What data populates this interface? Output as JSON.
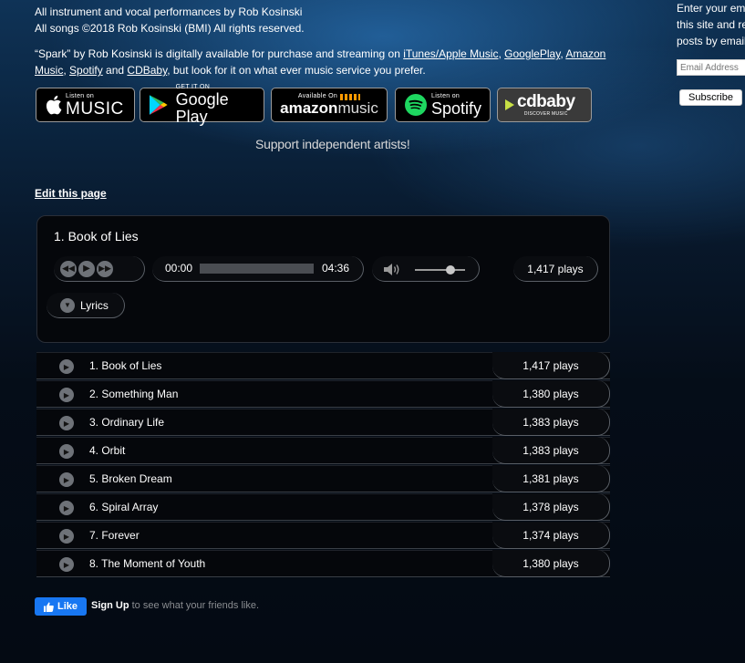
{
  "credits": {
    "line1": "All instrument and vocal performances by Rob Kosinski",
    "line2": "All songs ©2018 Rob Kosinski (BMI) All rights reserved.",
    "availability_pre": "“Spark” by Rob Kosinski is digitally available for purchase and streaming on ",
    "itunes_link": "iTunes/Apple Music",
    "comma1": ", ",
    "googleplay_link": "GooglePlay",
    "comma2": ", ",
    "amazon_link": "Amazon Music",
    "comma3": ", ",
    "spotify_link": "Spotify",
    "and_text": " and ",
    "cdbaby_link": "CDBaby",
    "availability_post": ", but look for it on what ever music service you prefer."
  },
  "badges": {
    "apple": {
      "small": "Listen on",
      "big": "MUSIC"
    },
    "google": {
      "small": "GET IT ON",
      "big": "Google Play"
    },
    "amazon": {
      "small": "Available On",
      "big": "amazon",
      "big2": "music"
    },
    "spotify": {
      "small": "Listen on",
      "big": "Spotify"
    },
    "cdbaby": {
      "big": "cdbaby",
      "small": "DISCOVER MUSIC"
    }
  },
  "support_text": "Support independent artists!",
  "edit_link": "Edit this page",
  "player": {
    "now_playing": "1. Book of Lies",
    "current_time": "00:00",
    "duration": "04:36",
    "plays": "1,417 plays",
    "lyrics_label": "Lyrics",
    "progress": 0,
    "volume": 0.7
  },
  "tracks": [
    {
      "title": "1. Book of Lies",
      "plays": "1,417 plays"
    },
    {
      "title": "2. Something Man",
      "plays": "1,380 plays"
    },
    {
      "title": "3. Ordinary Life",
      "plays": "1,383 plays"
    },
    {
      "title": "4. Orbit",
      "plays": "1,383 plays"
    },
    {
      "title": "5. Broken Dream",
      "plays": "1,381 plays"
    },
    {
      "title": "6. Spiral Array",
      "plays": "1,378 plays"
    },
    {
      "title": "7. Forever",
      "plays": "1,374 plays"
    },
    {
      "title": "8. The Moment of Youth",
      "plays": "1,380 plays"
    }
  ],
  "facebook": {
    "like_label": "Like",
    "signup": "Sign Up",
    "rest": " to see what your friends like."
  },
  "sidebar": {
    "line1": "Enter your em",
    "line2": "this site and re",
    "line3": "posts by email",
    "email_placeholder": "Email Address",
    "subscribe_label": "Subscribe"
  },
  "colors": {
    "accent_facebook": "#1877f2",
    "bg_dark": "#05070b"
  },
  "icons": [
    "apple-icon",
    "google-play-icon",
    "amazon-icon",
    "spotify-icon",
    "cdbaby-icon",
    "rewind-icon",
    "play-icon",
    "fast-forward-icon",
    "volume-icon",
    "chevron-down-icon",
    "thumbs-up-icon"
  ]
}
